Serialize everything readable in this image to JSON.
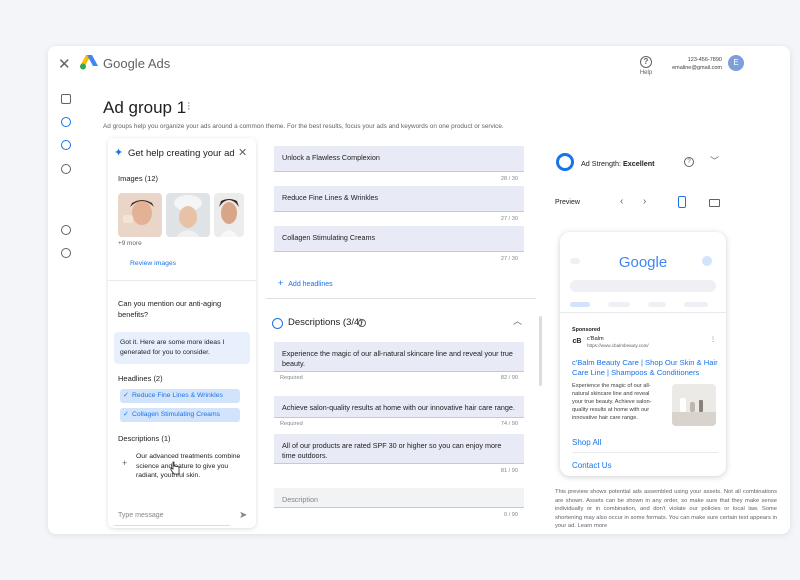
{
  "app": {
    "brand": "Google Ads",
    "help_label": "Help",
    "phone": "123-456-7890",
    "email": "emaline@gmail.com",
    "avatar_initial": "E"
  },
  "page": {
    "title": "Ad group 1",
    "subtitle": "Ad groups help you organize your ads around a common theme. For the best results, focus your ads and keywords on one product or service."
  },
  "assistant": {
    "title": "Get help creating your ad",
    "images_label": "Images (12)",
    "more_label": "+9 more",
    "review_label": "Review images",
    "question": "Can you mention our anti-aging benefits?",
    "reply": "Got it. Here are some more ideas I generated for you to consider.",
    "headlines_label": "Headlines (2)",
    "headlines": [
      "Reduce Fine Lines & Wrinkles",
      "Collagen Stimulating Creams"
    ],
    "descriptions_label": "Descriptions (1)",
    "description": "Our advanced treatments combine science and nature to give you radiant, youthful skin.",
    "input_placeholder": "Type message"
  },
  "editor": {
    "headlines": [
      {
        "text": "Unlock a Flawless Complexion",
        "count": "28 / 30"
      },
      {
        "text": "Reduce Fine Lines & Wrinkles",
        "count": "27 / 30"
      },
      {
        "text": "Collagen Stimulating Creams",
        "count": "27 / 30"
      }
    ],
    "add_headlines": "Add headlines",
    "descriptions_title": "Descriptions (3/4)",
    "descriptions": [
      {
        "text": "Experience the magic of our all-natural skincare line and reveal your true beauty.",
        "note": "Required",
        "count": "82 / 90"
      },
      {
        "text": "Achieve salon-quality results at home with our innovative hair care range.",
        "note": "Required",
        "count": "74 / 90"
      },
      {
        "text": "All of our products are rated SPF 30 or higher so you can enjoy more time outdoors.",
        "note": "",
        "count": "81 / 90"
      },
      {
        "text": "",
        "placeholder": "Description",
        "note": "",
        "count": "0 / 90"
      }
    ]
  },
  "preview": {
    "strength_label": "Ad Strength:",
    "strength_value": "Excellent",
    "label": "Preview",
    "google_logo": "Google",
    "sponsored": "Sponsored",
    "advertiser": "c'Balm",
    "url": "https://www.cbalmbeauty.com/",
    "ad_headline": "c'Balm Beauty Care | Shop Our Skin & Hair Care Line | Shampoos & Conditioners",
    "ad_description": "Experience the magic of our all-natural skincare line and reveal your true beauty. Achieve salon-quality results at home with our innovative hair care range.",
    "sitelinks": [
      "Shop All",
      "Contact Us"
    ],
    "disclaimer": "This preview shows potential ads assembled using your assets. Not all combinations are shown. Assets can be shown in any order, so make sure that they make sense individually or in combination, and don't violate our policies or local law. Some shortening may also occur in some formats. You can make sure certain text appears in your ad. Learn more"
  },
  "colors": {
    "accent": "#1a73e8",
    "chip_bg": "#d2e3fc",
    "field_bg": "#e8eaf6"
  }
}
